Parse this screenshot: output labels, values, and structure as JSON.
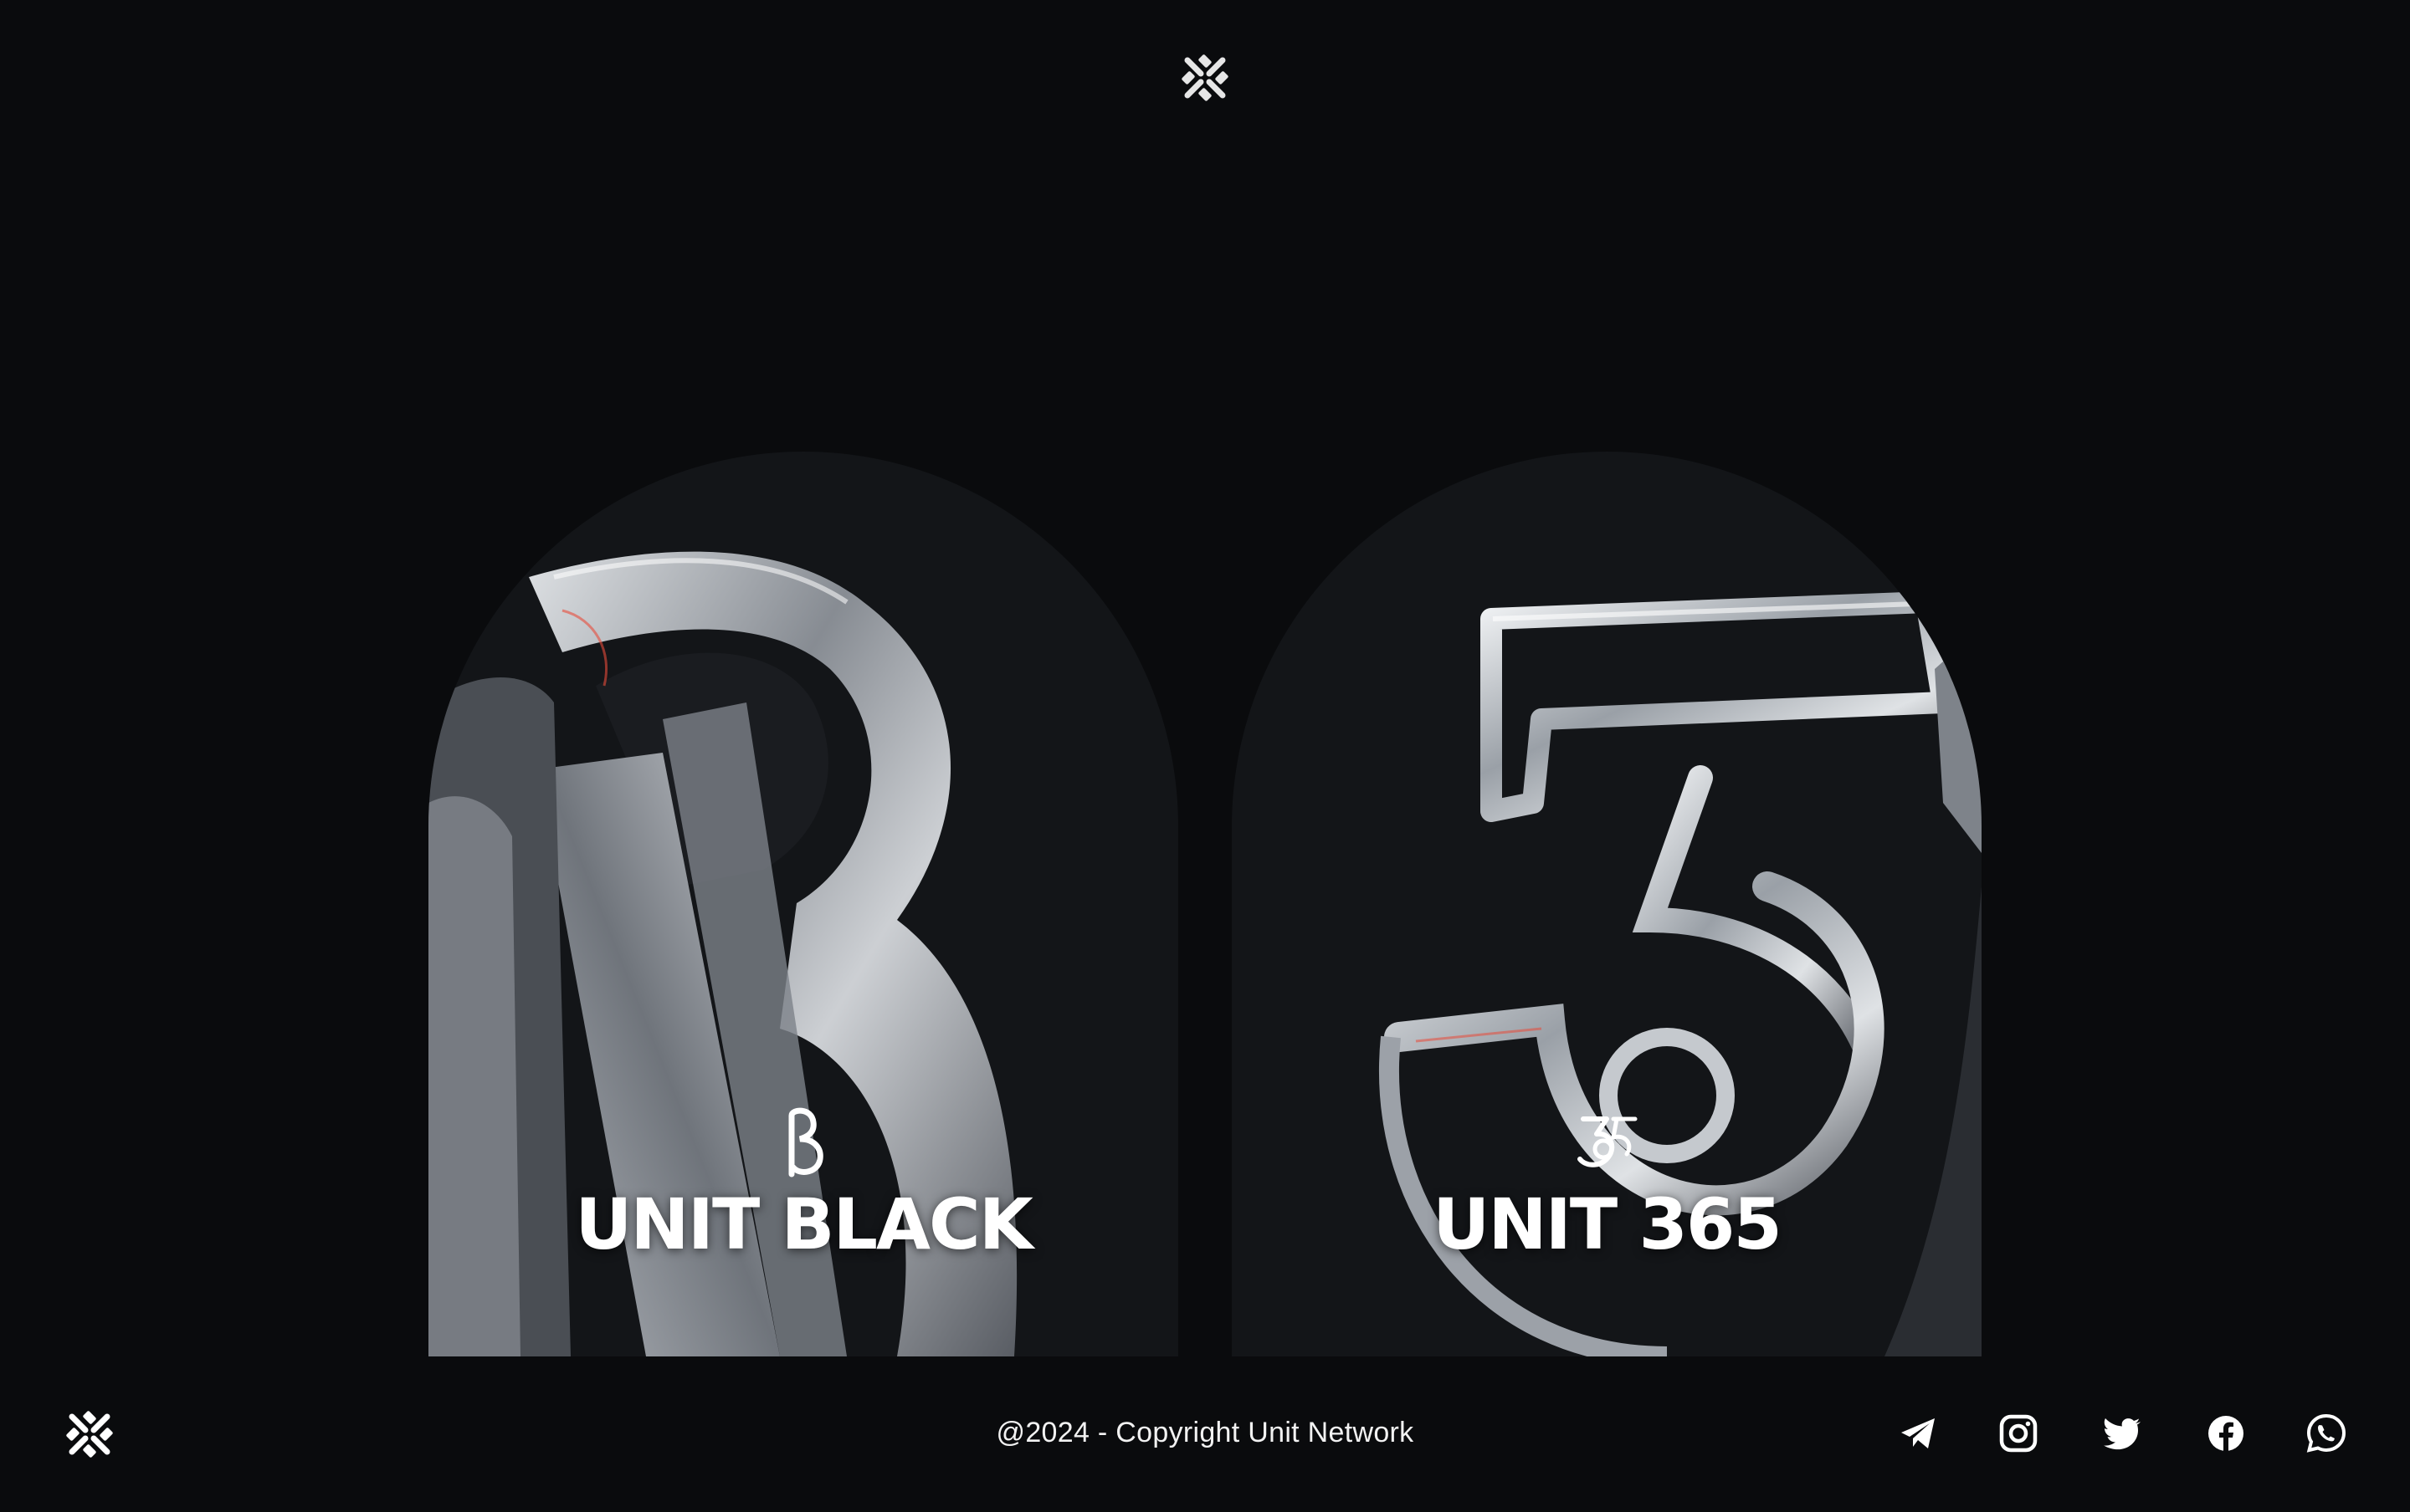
{
  "header": {
    "logo_icon": "unit-network-logo-icon"
  },
  "cards": [
    {
      "title": "UNIT BLACK",
      "icon": "unit-black-b-icon",
      "art": "chrome-b-letter-art"
    },
    {
      "title": "UNIT 365",
      "icon": "unit-365-icon",
      "art": "chrome-3-numeral-art"
    }
  ],
  "footer": {
    "logo_icon": "unit-network-logo-icon",
    "copyright": "@2024 - Copyright Unit Network",
    "social": [
      {
        "icon": "telegram-icon"
      },
      {
        "icon": "instagram-icon"
      },
      {
        "icon": "twitter-icon"
      },
      {
        "icon": "facebook-icon"
      },
      {
        "icon": "whatsapp-icon"
      }
    ]
  },
  "colors": {
    "background": "#0a0b0d",
    "card": "#131518",
    "text": "#ffffff",
    "chrome": "#b8bcc2"
  }
}
